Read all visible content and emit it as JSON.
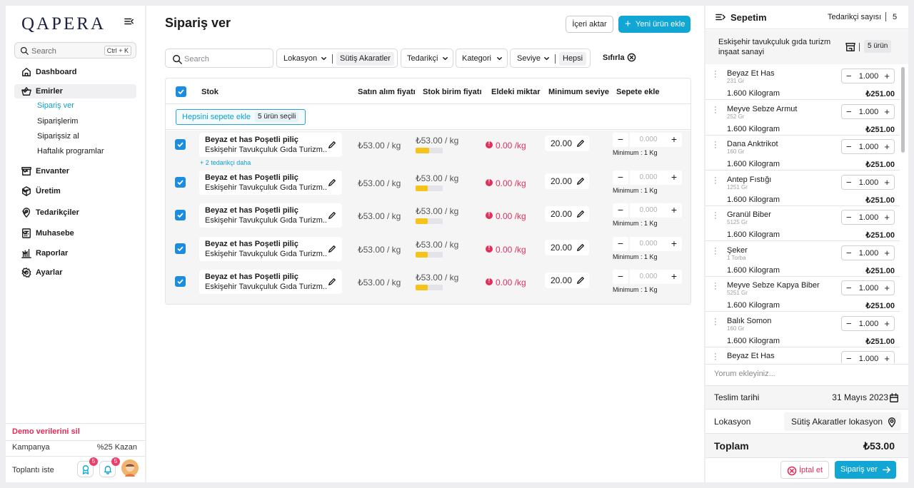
{
  "sidebar": {
    "logo": "QAPERA",
    "search": {
      "placeholder": "Search",
      "shortcut": "Ctrl + K"
    },
    "nav": [
      {
        "label": "Dashboard",
        "icon": "home-icon"
      },
      {
        "label": "Emirler",
        "icon": "basket-icon"
      },
      {
        "label": "Envanter",
        "icon": "box-icon"
      },
      {
        "label": "Üretim",
        "icon": "cube-icon"
      },
      {
        "label": "Tedarikçiler",
        "icon": "pin-icon"
      },
      {
        "label": "Muhasebe",
        "icon": "calculator-icon"
      },
      {
        "label": "Raporlar",
        "icon": "bar-chart-icon"
      },
      {
        "label": "Ayarlar",
        "icon": "gear-icon"
      }
    ],
    "emirler_sub": [
      "Sipariş ver",
      "Siparişlerim",
      "Siparişsiz al",
      "Haftalık programlar"
    ],
    "demo": "Demo verilerini sil",
    "campaign_label": "Kampanya",
    "campaign_value": "%25 Kazan",
    "meeting": "Toplantı iste",
    "award_badge": "5",
    "bell_badge": "5"
  },
  "main": {
    "title": "Sipariş ver",
    "import_label": "İçeri aktar",
    "new_product_label": "Yeni ürün ekle",
    "filters": {
      "search_placeholder": "Search",
      "location_label": "Lokasyon",
      "location_value": "Sütiş Akaratler",
      "supplier_label": "Tedarikçi",
      "category_label": "Kategori",
      "level_label": "Seviye",
      "level_value": "Hepsi",
      "reset_label": "Sıfırla"
    },
    "table": {
      "headers": [
        "Stok",
        "Satın alım fiyatı",
        "Stok birim fiyatı",
        "Eldeki miktar",
        "Minimum seviye",
        "Sepete ekle"
      ],
      "add_all_label": "Hepsini sepete ekle",
      "selected_label": "5 ürün seçili",
      "more_suppliers": "+ 2 tedarikçi daha",
      "rows": [
        {
          "name": "Beyaz et has Poşetli piliç",
          "supplier": "Eskişehir Tavukçuluk  Gıda Turizm...",
          "purchase_price": "₺53.00 / kg",
          "unit_price": "₺53.00 / kg",
          "level": 0.5,
          "on_hand": "0.00 /kg",
          "min_level": "20.00",
          "qty_placeholder": "0.000",
          "min_text": "Minimum :  1 Kg"
        },
        {
          "name": "Beyaz et has Poşetli piliç",
          "supplier": "Eskişehir Tavukçuluk  Gıda Turizm...",
          "purchase_price": "₺53.00 / kg",
          "unit_price": "₺53.00 / kg",
          "level": 0.45,
          "on_hand": "0.00 /kg",
          "min_level": "20.00",
          "qty_placeholder": "0.000",
          "min_text": "Minimum :  1 Kg"
        },
        {
          "name": "Beyaz et has Poşetli piliç",
          "supplier": "Eskişehir Tavukçuluk  Gıda Turizm...",
          "purchase_price": "₺53.00 / kg",
          "unit_price": "₺53.00 / kg",
          "level": 0.45,
          "on_hand": "0.00 /kg",
          "min_level": "20.00",
          "qty_placeholder": "0.000",
          "min_text": "Minimum :  1 Kg"
        },
        {
          "name": "Beyaz et has Poşetli piliç",
          "supplier": "Eskişehir Tavukçuluk  Gıda Turizm...",
          "purchase_price": "₺53.00 / kg",
          "unit_price": "₺53.00 / kg",
          "level": 0.45,
          "on_hand": "0.00 /kg",
          "min_level": "20.00",
          "qty_placeholder": "0.000",
          "min_text": "Minimum :  1 Kg"
        },
        {
          "name": "Beyaz et has Poşetli piliç",
          "supplier": "Eskişehir Tavukçuluk  Gıda Turizm...",
          "purchase_price": "₺53.00 / kg",
          "unit_price": "₺53.00 / kg",
          "level": 0.45,
          "on_hand": "0.00 /kg",
          "min_level": "20.00",
          "qty_placeholder": "0.000",
          "min_text": "Minimum :  1 Kg"
        }
      ]
    }
  },
  "cart": {
    "title": "Sepetim",
    "supplier_count_label": "Tedarikçi sayısı",
    "supplier_count": "5",
    "supplier_name": "Eskişehir tavukçuluk gıda turizm inşaat sanayi",
    "item_count": "5 ürün",
    "items": [
      {
        "name": "Beyaz Et Has",
        "sub": "231 Gr",
        "qty": "1.000",
        "weight": "1.600 Kilogram",
        "price": "₺251.00"
      },
      {
        "name": "Meyve Sebze Armut",
        "sub": "252 Gr",
        "qty": "1.000",
        "weight": "1.600 Kilogram",
        "price": "₺251.00"
      },
      {
        "name": "Dana Anktrikot",
        "sub": "160 Gr",
        "qty": "1.000",
        "weight": "1.600 Kilogram",
        "price": "₺251.00"
      },
      {
        "name": "Antep Fıstığı",
        "sub": "1251 Gr",
        "qty": "1.000",
        "weight": "1.600 Kilogram",
        "price": "₺251.00"
      },
      {
        "name": "Granül Biber",
        "sub": "5125 Gr",
        "qty": "1.000",
        "weight": "1.600 Kilogram",
        "price": "₺251.00"
      },
      {
        "name": "Şeker",
        "sub": "1 Torba",
        "qty": "1.000",
        "weight": "1.600 Kilogram",
        "price": "₺251.00"
      },
      {
        "name": "Meyve Sebze Kapya Biber",
        "sub": "5251 Gr",
        "qty": "1.000",
        "weight": "1.600 Kilogram",
        "price": "₺251.00"
      },
      {
        "name": "Balık Somon",
        "sub": "160 Gr",
        "qty": "1.000",
        "weight": "1.600 Kilogram",
        "price": "₺251.00"
      },
      {
        "name": "Beyaz Et Has",
        "sub": "",
        "qty": "1.000",
        "weight": "",
        "price": ""
      }
    ],
    "comment_placeholder": "Yorum ekleyiniz...",
    "delivery_label": "Teslim tarihi",
    "delivery_value": "31 Mayıs 2023",
    "location_label": "Lokasyon",
    "location_value": "Sütiş Akaratler lokasyon",
    "total_label": "Toplam",
    "total_value": "₺53.00",
    "cancel_label": "İptal et",
    "order_label": "Sipariş ver"
  },
  "colors": {
    "accent": "#12a6d4",
    "danger": "#e0305c",
    "checkbox": "#1a8de0",
    "level_bar": "#f6c31b"
  }
}
